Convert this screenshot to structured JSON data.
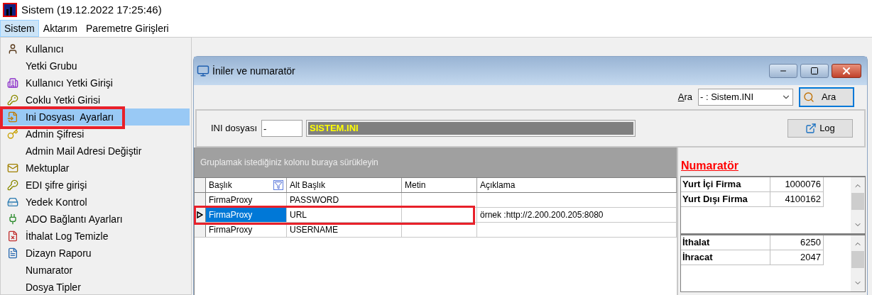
{
  "window": {
    "title": "Sistem (19.12.2022 17:25:46)"
  },
  "menubar": [
    {
      "label": "Sistem",
      "selected": true
    },
    {
      "label": "Aktarım",
      "selected": false
    },
    {
      "label": "Paremetre Girişleri",
      "selected": false
    }
  ],
  "menu": [
    {
      "label": "Kullanıcı",
      "kind": "person",
      "selected": false
    },
    {
      "label": "Yetki Grubu",
      "kind": "plain",
      "selected": false
    },
    {
      "label": "Kullanıcı Yetki Girişi",
      "kind": "building",
      "selected": false
    },
    {
      "label": "Coklu Yetki Girisi",
      "kind": "keys",
      "selected": false
    },
    {
      "label": "Ini Dosyası  Ayarları",
      "kind": "import",
      "selected": true
    },
    {
      "label": "Admin Şifresi",
      "kind": "key",
      "selected": false
    },
    {
      "label": "Admin Mail Adresi Değiştir",
      "kind": "plain",
      "selected": false
    },
    {
      "label": "Mektuplar",
      "kind": "envelope",
      "selected": false
    },
    {
      "label": "EDI şifre girişi",
      "kind": "keys",
      "selected": false
    },
    {
      "label": "Yedek Kontrol",
      "kind": "backup",
      "selected": false
    },
    {
      "label": "ADO Bağlantı Ayarları",
      "kind": "plug",
      "selected": false
    },
    {
      "label": "İthalat Log Temizle",
      "kind": "clean",
      "selected": false
    },
    {
      "label": "Dizayn Raporu",
      "kind": "report",
      "selected": false
    },
    {
      "label": "Numarator",
      "kind": "plain",
      "selected": false
    },
    {
      "label": "Dosya Tipler",
      "kind": "plain",
      "selected": false
    }
  ],
  "child": {
    "title": "İniler ve numaratör",
    "search": {
      "label": "Ara",
      "value": "- : Sistem.INI",
      "button": "Ara"
    },
    "ini": {
      "label": "INI dosyası",
      "code": "-",
      "name": "SISTEM.INI",
      "log_button": "Log"
    },
    "grid": {
      "group_hint": "Gruplamak istediğiniz kolonu buraya sürükleyin",
      "columns": [
        "Başlık",
        "Alt Başlık",
        "Metin",
        "Açıklama"
      ],
      "rows": [
        {
          "cells": [
            "FirmaProxy",
            "PASSWORD",
            "",
            ""
          ],
          "selected": false
        },
        {
          "cells": [
            "FirmaProxy",
            "URL",
            "",
            "örnek :http://2.200.200.205:8080"
          ],
          "selected": true
        },
        {
          "cells": [
            "FirmaProxy",
            "USERNAME",
            "",
            ""
          ],
          "selected": false
        }
      ]
    },
    "numerator": {
      "title": "Numaratör",
      "groups": [
        [
          {
            "label": "Yurt İçi Firma",
            "value": "1000076"
          },
          {
            "label": "Yurt Dışı Firma",
            "value": "4100162"
          }
        ],
        [
          {
            "label": "İthalat",
            "value": "6250"
          },
          {
            "label": "İhracat",
            "value": "2047"
          }
        ]
      ]
    }
  }
}
